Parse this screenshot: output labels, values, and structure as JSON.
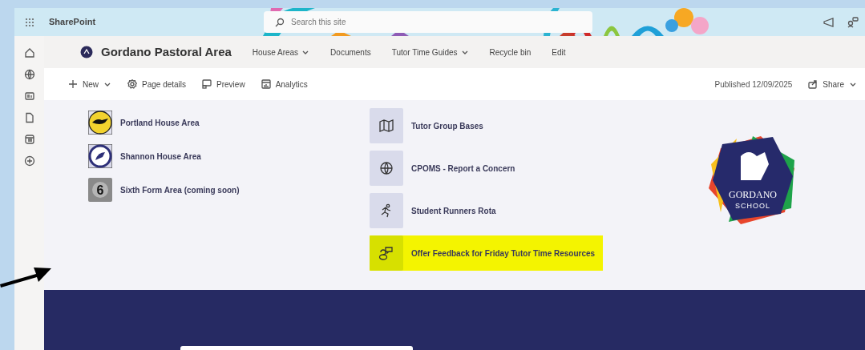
{
  "suite_bar": {
    "app_name": "SharePoint",
    "search": {
      "placeholder": "Search this site"
    }
  },
  "site_header": {
    "title": "Gordano Pastoral Area",
    "nav": [
      {
        "label": "House Areas",
        "dropdown": true
      },
      {
        "label": "Documents",
        "dropdown": false
      },
      {
        "label": "Tutor Time Guides",
        "dropdown": true
      },
      {
        "label": "Recycle bin",
        "dropdown": false
      },
      {
        "label": "Edit",
        "dropdown": false
      }
    ]
  },
  "command_bar": {
    "actions": [
      {
        "kind": "new",
        "label": "New"
      },
      {
        "kind": "details",
        "label": "Page details"
      },
      {
        "kind": "preview",
        "label": "Preview"
      },
      {
        "kind": "analytics",
        "label": "Analytics"
      }
    ],
    "published": "Published 12/09/2025",
    "share": "Share"
  },
  "house_links": [
    {
      "kind": "portland",
      "label": "Portland House Area"
    },
    {
      "kind": "shannon",
      "label": "Shannon House Area"
    },
    {
      "kind": "sixth",
      "label": "Sixth Form Area (coming soon)",
      "badge": "6"
    }
  ],
  "quick_links": [
    {
      "kind": "map",
      "label": "Tutor Group Bases",
      "highlighted": false
    },
    {
      "kind": "globe",
      "label": "CPOMS - Report a Concern",
      "highlighted": false
    },
    {
      "kind": "runner",
      "label": "Student Runners Rota",
      "highlighted": false
    },
    {
      "kind": "feedback",
      "label": "Offer Feedback for Friday Tutor Time Resources",
      "highlighted": true
    }
  ],
  "school_logo": {
    "name": "GORDANO",
    "subtitle": "SCHOOL"
  }
}
